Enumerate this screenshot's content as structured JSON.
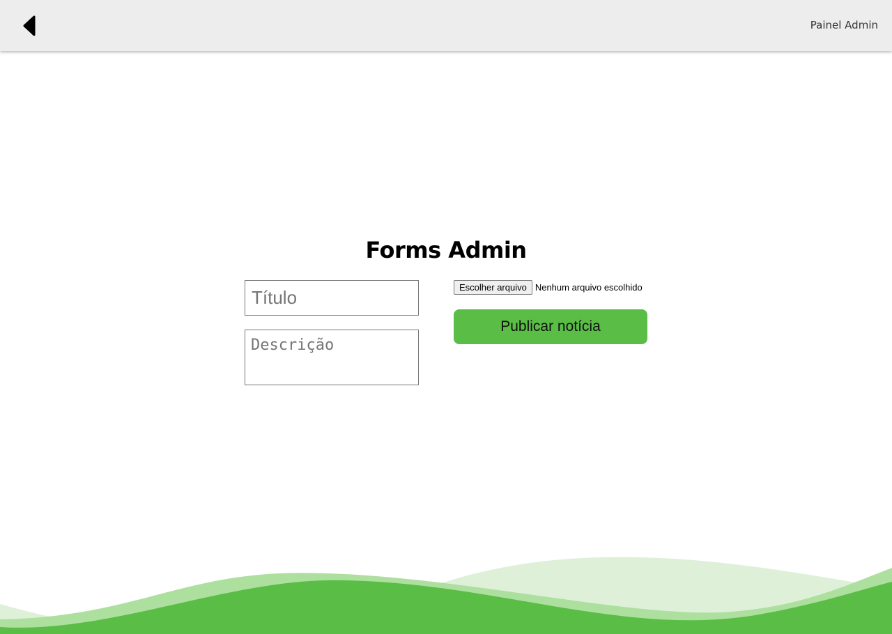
{
  "header": {
    "back_icon": "back-triangle-icon",
    "title": "Painel Admin"
  },
  "form": {
    "heading": "Forms Admin",
    "title_placeholder": "Título",
    "description_placeholder": "Descrição",
    "file_button_label": "Escolher arquivo",
    "file_status": "Nenhum arquivo escolhido",
    "submit_label": "Publicar notícia"
  },
  "colors": {
    "accent": "#5abd46",
    "accent_mid": "#addf9f",
    "accent_light": "#def1d8",
    "topbar": "#ededed"
  }
}
